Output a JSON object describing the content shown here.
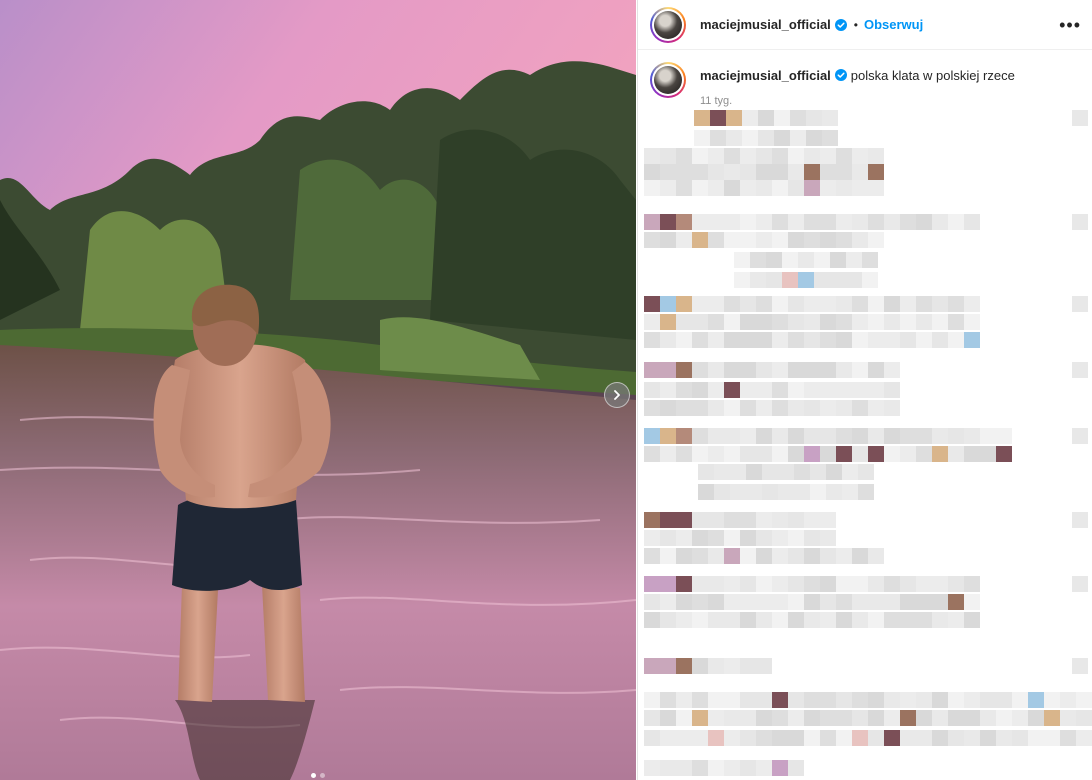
{
  "post": {
    "username": "maciejmusial_official",
    "follow_label": "Obserwuj",
    "bullet": "•",
    "more_label": "•••",
    "caption": "polska klata w polskiej rzece",
    "time_ago": "11 tyg."
  },
  "carousel": {
    "current_index": 1,
    "total": 2
  },
  "colors": {
    "accent": "#0095f6",
    "verified": "#0095f6",
    "text": "#262626",
    "muted": "#8e8e8e"
  },
  "icons": {
    "next": "chevron-right-icon",
    "verified": "verified-badge-icon",
    "more": "more-options-icon"
  }
}
